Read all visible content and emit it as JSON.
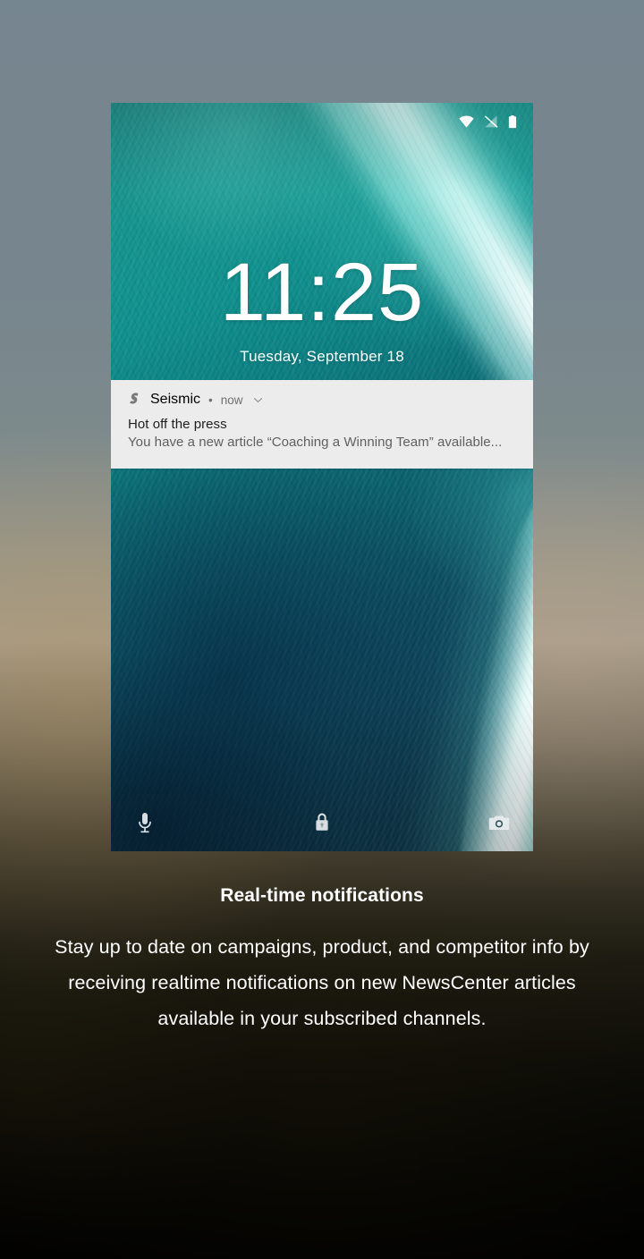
{
  "colors": {
    "card_bg": "#ececec",
    "card_title": "#1f1f1f",
    "card_body": "#606060",
    "card_meta": "#707070",
    "caption_text": "#ffffff",
    "wallpaper_teal": "#0f8f8c",
    "wallpaper_deep": "#0d4257"
  },
  "phone": {
    "status_bar": {
      "icons": [
        "wifi-icon",
        "no-sim-signal-icon",
        "battery-icon"
      ]
    },
    "lockscreen": {
      "time": "11:25",
      "date": "Tuesday, September 18"
    },
    "notification": {
      "app_icon": "seismic-s-logo-icon",
      "app_name": "Seismic",
      "separator": "•",
      "time": "now",
      "expand_icon": "chevron-down-icon",
      "title": "Hot off the press",
      "body": "You have a new article “Coaching a Winning Team” available..."
    },
    "shortcuts": [
      {
        "name": "microphone-icon",
        "label": "Voice assist"
      },
      {
        "name": "lock-icon",
        "label": "Locked"
      },
      {
        "name": "camera-icon",
        "label": "Camera"
      }
    ]
  },
  "caption": {
    "title": "Real-time notifications",
    "body": "Stay up to date on campaigns, product, and competitor info by receiving realtime notifications on new NewsCenter articles available in your subscribed channels."
  }
}
